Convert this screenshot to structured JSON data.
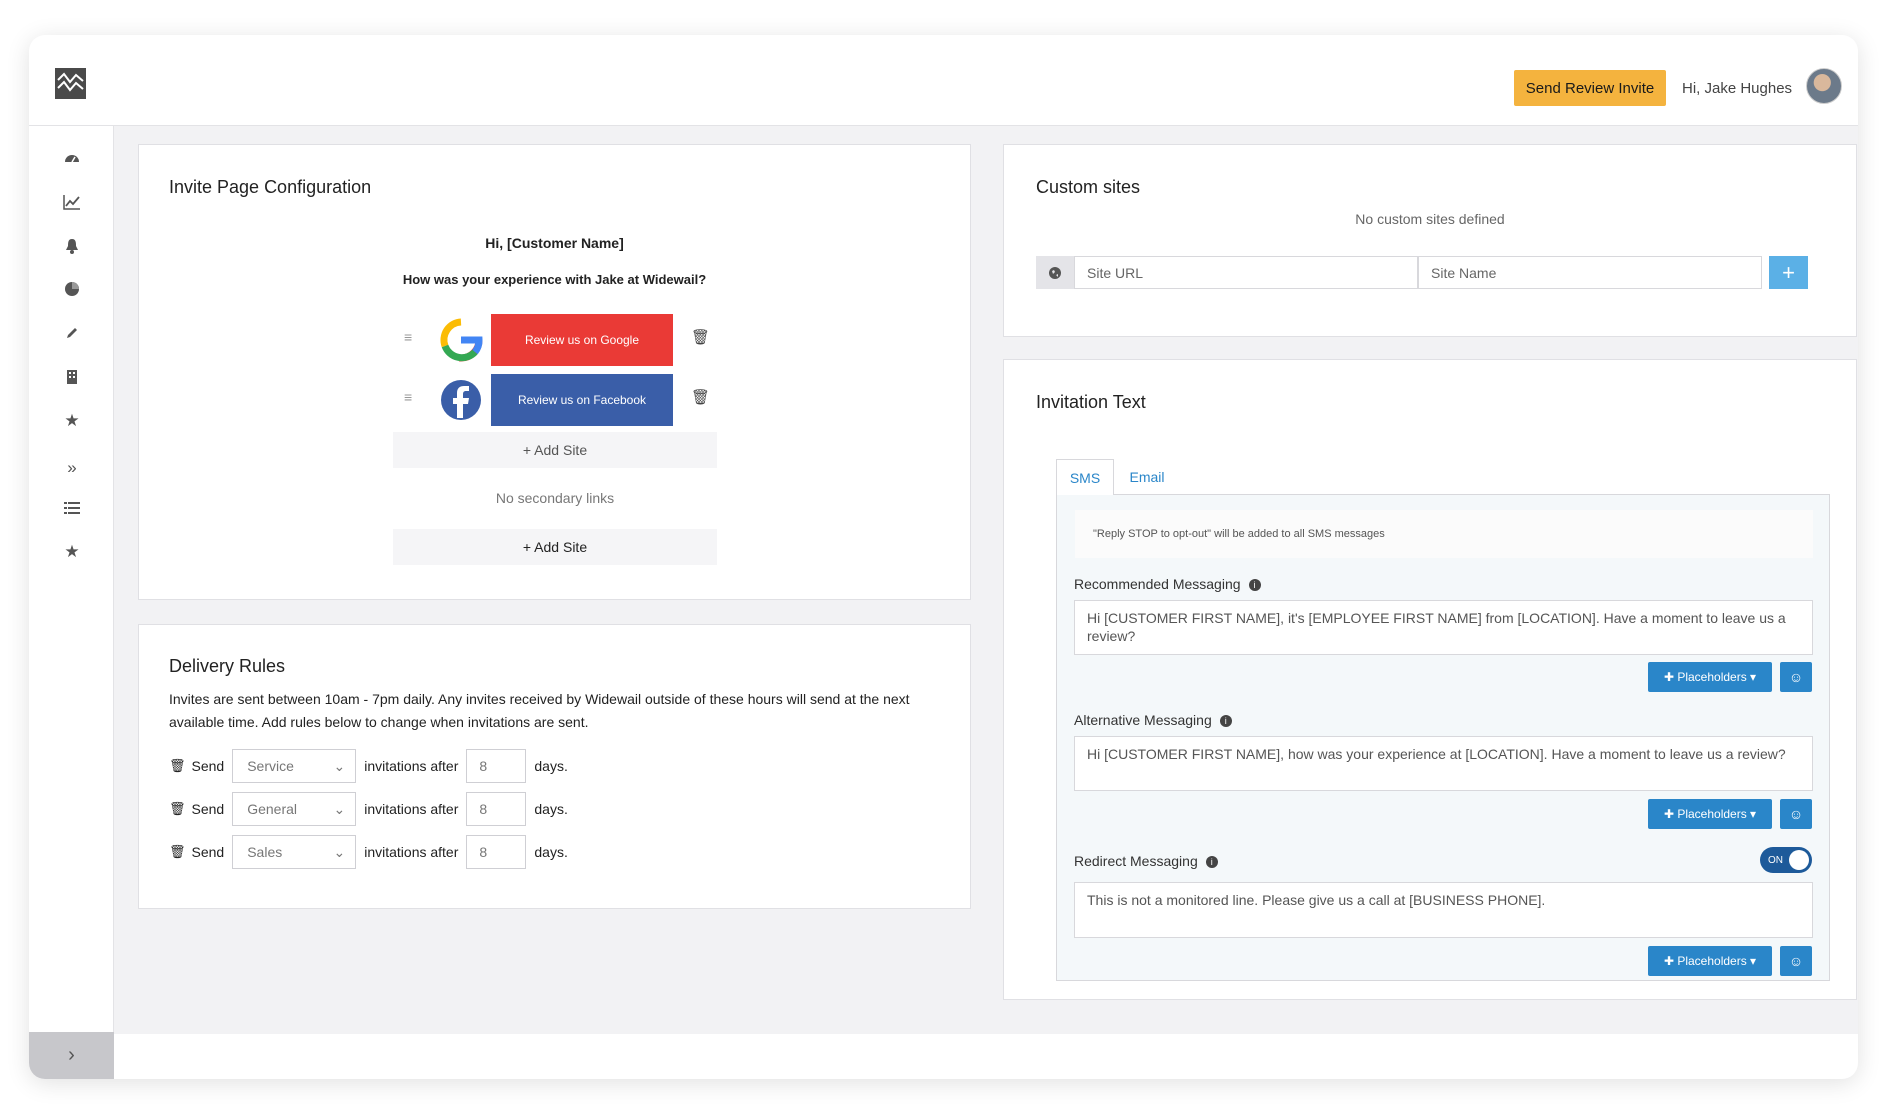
{
  "header": {
    "cta_label": "Send Review Invite",
    "greeting": "Hi, Jake Hughes"
  },
  "sidebar": {
    "icons": [
      "dashboard-icon",
      "chart-line-icon",
      "bell-icon",
      "pie-chart-icon",
      "pencil-icon",
      "building-icon",
      "star-icon",
      "double-chevron-right-icon",
      "list-icon",
      "star-icon"
    ],
    "expand_icon": "chevron-right-icon"
  },
  "invite_config": {
    "title": "Invite Page Configuration",
    "greeting": "Hi, [Customer Name]",
    "question": "How was your experience with Jake at Widewail?",
    "sites": [
      {
        "label": "Review us on Google",
        "color": "#ea3a36",
        "icon": "google-icon"
      },
      {
        "label": "Review us on Facebook",
        "color": "#3a5ea8",
        "icon": "facebook-icon"
      }
    ],
    "add_site_label": "+ Add Site",
    "no_secondary": "No secondary links",
    "add_site_label_2": "+ Add Site"
  },
  "delivery": {
    "title": "Delivery Rules",
    "description": "Invites are sent between 10am - 7pm daily. Any invites received by Widewail outside of these hours will send at the next available time. Add rules below to change when invitations are sent.",
    "rules": [
      {
        "send": "Send",
        "type": "Service",
        "after": "invitations after",
        "days_value": "8",
        "days": "days."
      },
      {
        "send": "Send",
        "type": "General",
        "after": "invitations after",
        "days_value": "8",
        "days": "days."
      },
      {
        "send": "Send",
        "type": "Sales",
        "after": "invitations after",
        "days_value": "8",
        "days": "days."
      }
    ]
  },
  "custom_sites": {
    "title": "Custom sites",
    "empty": "No custom sites defined",
    "url_placeholder": "Site URL",
    "name_placeholder": "Site Name",
    "add_label": "+"
  },
  "invitation_text": {
    "title": "Invitation Text",
    "tabs": [
      "SMS",
      "Email"
    ],
    "notice": "\"Reply STOP to opt-out\" will be added to all SMS messages",
    "recommended_label": "Recommended Messaging",
    "recommended_text": "Hi [CUSTOMER FIRST NAME], it's [EMPLOYEE FIRST NAME] from [LOCATION]. Have a moment to leave us a review?",
    "alternative_label": "Alternative Messaging",
    "alternative_text": "Hi [CUSTOMER FIRST NAME], how was your experience at [LOCATION]. Have a moment to leave us a review?",
    "redirect_label": "Redirect Messaging",
    "redirect_toggle": "ON",
    "redirect_text": "This is not a monitored line. Please give us a call at [BUSINESS PHONE].",
    "placeholders_label": "Placeholders"
  }
}
